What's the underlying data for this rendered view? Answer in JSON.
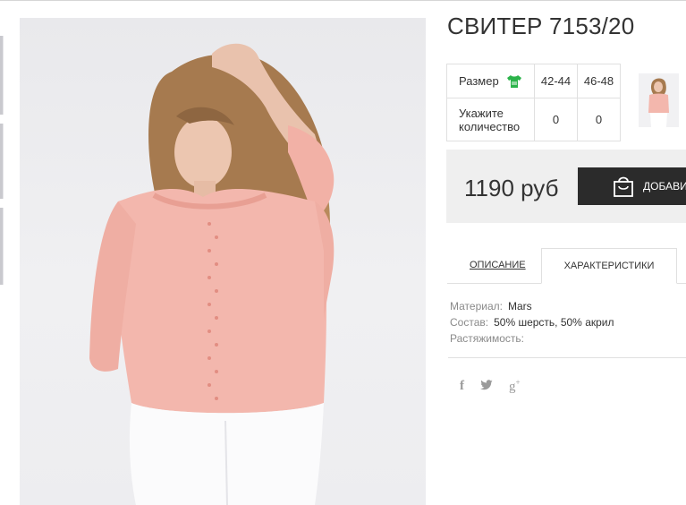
{
  "product": {
    "title": "СВИТЕР 7153/20"
  },
  "size_table": {
    "size_label": "Размер",
    "size_icon": "tshirt-icon",
    "qty_label_line1": "Укажите",
    "qty_label_line2": "количество",
    "sizes": [
      "42-44",
      "46-48"
    ],
    "quantities": [
      "0",
      "0"
    ]
  },
  "purchase": {
    "price": "1190 руб",
    "add_button_label": "ДОБАВИТ",
    "add_button_icon": "shopping-bag-icon"
  },
  "tabs": {
    "description": "ОПИСАНИЕ",
    "characteristics": "ХАРАКТЕРИСТИКИ",
    "active": "characteristics"
  },
  "specs": {
    "material_label": "Материал:",
    "material_value": "Mars",
    "composition_label": "Состав:",
    "composition_value": "50% шерсть, 50% акрил",
    "stretch_label": "Растяжимость:",
    "stretch_value": ""
  },
  "social": {
    "facebook": "f",
    "twitter_icon": "twitter-icon",
    "googleplus": "g",
    "googleplus_sup": "+"
  },
  "colors": {
    "accent_dark": "#2b2b2b",
    "price_bg": "#efefef",
    "size_icon_green": "#2bb34a",
    "sweater_pink": "#f3b7ad"
  }
}
